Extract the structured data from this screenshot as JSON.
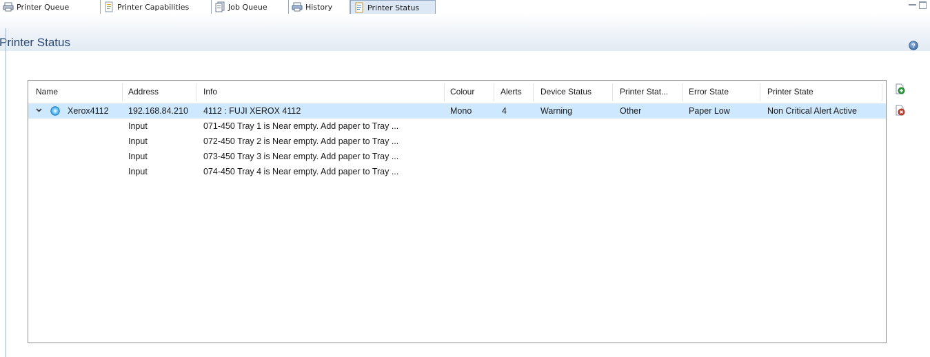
{
  "tabs": [
    {
      "label": "Printer Queue",
      "icon": "printer-queue-icon"
    },
    {
      "label": "Printer Capabilities",
      "icon": "capabilities-icon"
    },
    {
      "label": "Job Queue",
      "icon": "job-queue-icon"
    },
    {
      "label": "History",
      "icon": "history-icon"
    },
    {
      "label": "Printer Status",
      "icon": "printer-status-icon",
      "active": true
    }
  ],
  "view": {
    "title": "Printer Status"
  },
  "table": {
    "columns": [
      "Name",
      "Address",
      "Info",
      "Colour",
      "Alerts",
      "Device Status",
      "Printer Stat...",
      "Error State",
      "Printer State"
    ],
    "printer": {
      "name": "Xerox4112",
      "address": "192.168.84.210",
      "info": "4112  : FUJI XEROX 4112",
      "colour": "Mono",
      "alerts": "4",
      "device_status": "Warning",
      "printer_status": "Other",
      "error_state": "Paper Low",
      "printer_state": "Non Critical Alert Active"
    },
    "alerts": [
      {
        "address": "Input",
        "info": "071-450 Tray 1 is Near empty. Add paper to Tray ..."
      },
      {
        "address": "Input",
        "info": "072-450 Tray 2 is Near empty. Add paper to Tray ..."
      },
      {
        "address": "Input",
        "info": "073-450 Tray 3 is Near empty. Add paper to Tray ..."
      },
      {
        "address": "Input",
        "info": "074-450 Tray 4 is Near empty. Add paper to Tray ..."
      }
    ]
  },
  "colors": {
    "accent_title": "#24477a",
    "selection": "#cde8ff",
    "add": "#2e9e3e",
    "remove": "#d33a2c"
  }
}
